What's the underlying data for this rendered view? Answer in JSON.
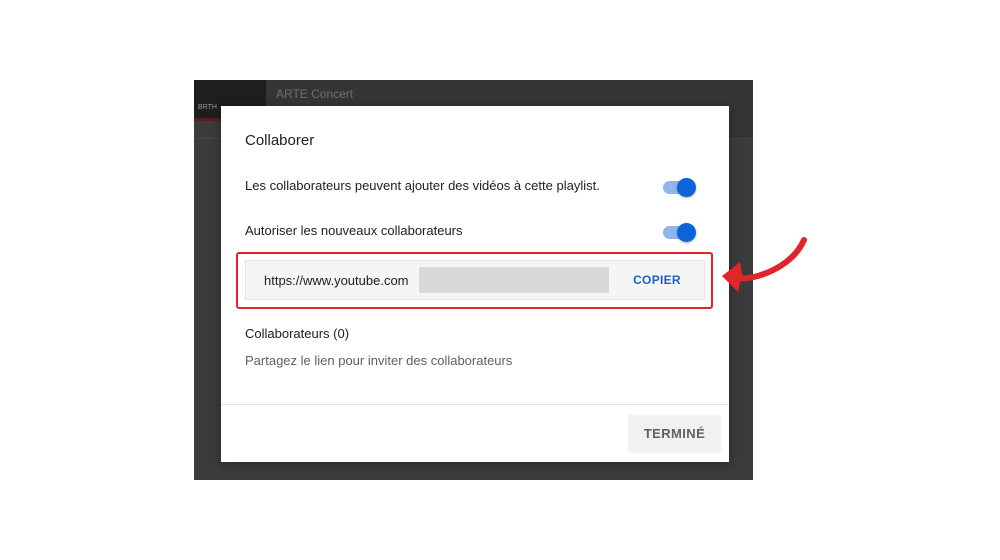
{
  "background": {
    "thumb_label": "BRTH",
    "channel_title": "ARTE Concert"
  },
  "dialog": {
    "title": "Collaborer",
    "settings": [
      {
        "label": "Les collaborateurs peuvent ajouter des vidéos à cette playlist.",
        "enabled": true
      },
      {
        "label": "Autoriser les nouveaux collaborateurs",
        "enabled": true
      }
    ],
    "share_link": {
      "value": "https://www.youtube.com",
      "copy_label": "COPIER"
    },
    "collaborators": {
      "heading": "Collaborateurs (0)",
      "hint": "Partagez le lien pour inviter des collaborateurs"
    },
    "done_label": "TERMINÉ"
  },
  "colors": {
    "accent_blue": "#0b64d8",
    "highlight_red": "#e0252b",
    "backdrop": "#3b3b3b"
  },
  "annotation": {
    "icon": "curved-arrow-icon"
  }
}
